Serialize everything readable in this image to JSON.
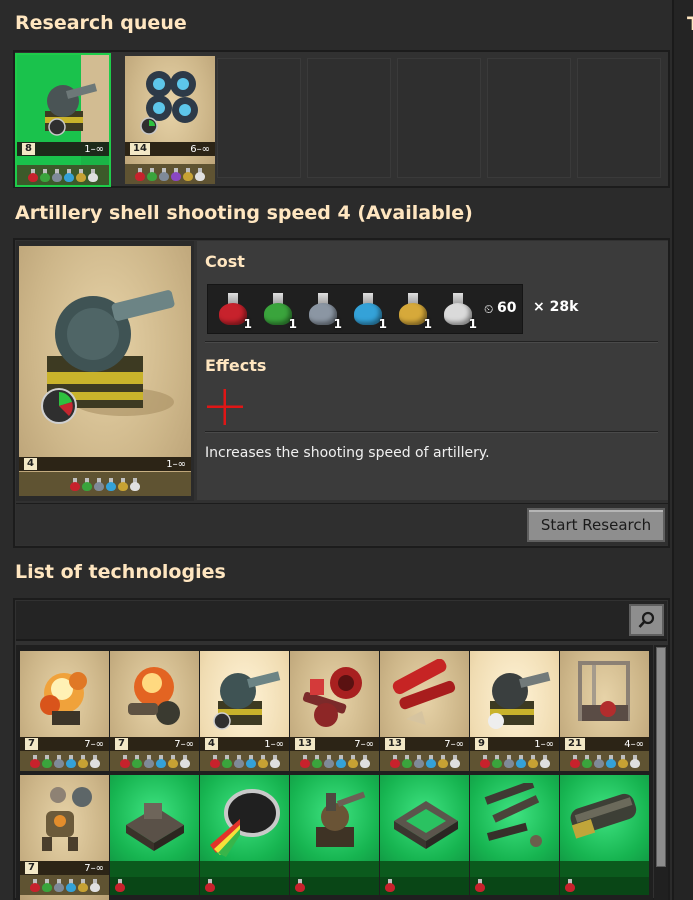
{
  "queue": {
    "title": "Research queue",
    "items": [
      {
        "name": "Artillery shell range",
        "level": "8",
        "range": "1–∞",
        "packs": [
          "#c7222c",
          "#3aa43c",
          "#7f8a98",
          "#34a2d8",
          "#c7a233",
          "#e0e0e0"
        ],
        "progress": 0.75
      },
      {
        "name": "Physical projectile damage",
        "level": "14",
        "range": "6–∞",
        "packs": [
          "#c7222c",
          "#3aa43c",
          "#7f8a98",
          "#8a47c2",
          "#c7a233",
          "#e0e0e0"
        ],
        "progress": 0
      }
    ]
  },
  "selected": {
    "title": "Artillery shell shooting speed 4 (Available)",
    "card": {
      "level": "4",
      "range": "1–∞",
      "packs": [
        "#c7222c",
        "#3aa43c",
        "#7f8a98",
        "#34a2d8",
        "#c7a233",
        "#e0e0e0"
      ]
    },
    "cost_label": "Cost",
    "cost": [
      {
        "color": "#c7222c",
        "count": "1"
      },
      {
        "color": "#3aa43c",
        "count": "1"
      },
      {
        "color": "#8b96a3",
        "count": "1"
      },
      {
        "color": "#34a2d8",
        "count": "1"
      },
      {
        "color": "#d6a93a",
        "count": "1"
      },
      {
        "color": "#dadada",
        "count": "1"
      }
    ],
    "time": "60",
    "multiplier": "× 28k",
    "effects_label": "Effects",
    "description": "Increases the shooting speed of artillery.",
    "start_button": "Start Research"
  },
  "technologies": {
    "title": "List of technologies",
    "search_placeholder": "",
    "row1": [
      {
        "name": "Explosive damage",
        "level": "7",
        "range": "7–∞",
        "packs": [
          "#c7222c",
          "#3aa43c",
          "#7f8a98",
          "#34a2d8",
          "#c7a233",
          "#e0e0e0"
        ],
        "highlight": false
      },
      {
        "name": "Stronger explosives",
        "level": "7",
        "range": "7–∞",
        "packs": [
          "#c7222c",
          "#3aa43c",
          "#7f8a98",
          "#34a2d8",
          "#c7a233",
          "#e0e0e0"
        ],
        "highlight": false
      },
      {
        "name": "Artillery shell shooting speed",
        "level": "4",
        "range": "1–∞",
        "packs": [
          "#c7222c",
          "#3aa43c",
          "#7f8a98",
          "#34a2d8",
          "#c7a233",
          "#e0e0e0"
        ],
        "highlight": true
      },
      {
        "name": "Refined flammables",
        "level": "13",
        "range": "7–∞",
        "packs": [
          "#c7222c",
          "#3aa43c",
          "#7f8a98",
          "#34a2d8",
          "#c7a233",
          "#e0e0e0"
        ],
        "highlight": false
      },
      {
        "name": "Weapon shooting speed",
        "level": "13",
        "range": "7–∞",
        "packs": [
          "#c7222c",
          "#3aa43c",
          "#7f8a98",
          "#34a2d8",
          "#c7a233",
          "#e0e0e0"
        ],
        "highlight": false
      },
      {
        "name": "Artillery shell range",
        "level": "9",
        "range": "1–∞",
        "packs": [
          "#c7222c",
          "#3aa43c",
          "#7f8a98",
          "#34a2d8",
          "#c7a233",
          "#e0e0e0"
        ],
        "highlight": true
      },
      {
        "name": "Mining productivity",
        "level": "21",
        "range": "4–∞",
        "packs": [
          "#c7222c",
          "#3aa43c",
          "#7f8a98",
          "#34a2d8",
          "#c7a233",
          "#e0e0e0"
        ],
        "highlight": false
      }
    ],
    "row2": [
      {
        "name": "Follower robot count",
        "level": "7",
        "range": "7–∞",
        "packs": [
          "#c7222c",
          "#3aa43c",
          "#7f8a98",
          "#34a2d8",
          "#c7a233",
          "#e0e0e0"
        ],
        "green": false
      },
      {
        "name": "Automation",
        "green": true
      },
      {
        "name": "Optics",
        "green": true
      },
      {
        "name": "Turrets",
        "green": true
      },
      {
        "name": "Stone wall",
        "green": true
      },
      {
        "name": "Military",
        "green": true
      },
      {
        "name": "Logistics",
        "green": true
      }
    ]
  }
}
